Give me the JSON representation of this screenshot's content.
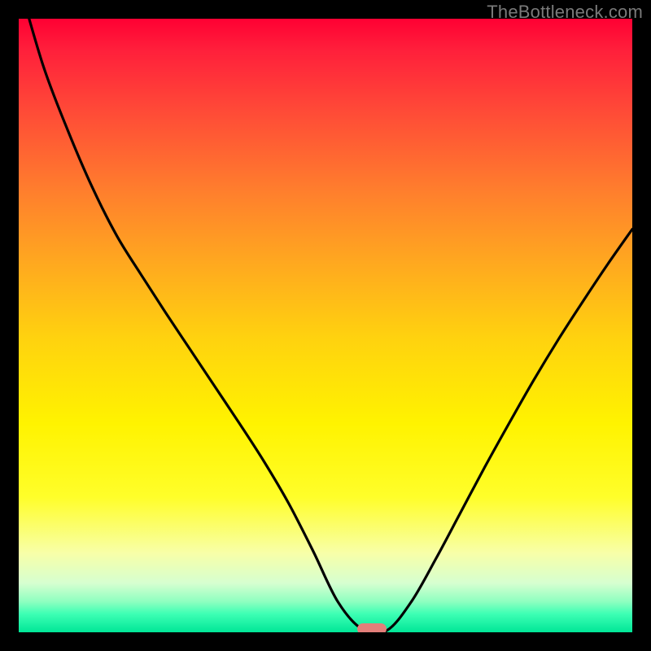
{
  "watermark": {
    "text": "TheBottleneck.com"
  },
  "colors": {
    "page_bg": "#000000",
    "curve": "#000000",
    "marker": "#e37f7a",
    "gradient_stops": [
      "#ff0033",
      "#ff1f3b",
      "#ff4a37",
      "#ff7e2d",
      "#ffa91f",
      "#ffd20f",
      "#fff300",
      "#fffe2a",
      "#f8ffa7",
      "#d6ffd0",
      "#8effc0",
      "#3dffb4",
      "#00e697"
    ]
  },
  "chart_data": {
    "type": "line",
    "title": "",
    "xlabel": "",
    "ylabel": "",
    "xlim": [
      0,
      1
    ],
    "ylim": [
      0,
      1
    ],
    "x": [
      0.0,
      0.04,
      0.08,
      0.12,
      0.16,
      0.2,
      0.24,
      0.28,
      0.32,
      0.36,
      0.4,
      0.44,
      0.48,
      0.52,
      0.56,
      0.6,
      0.64,
      0.68,
      0.72,
      0.76,
      0.8,
      0.84,
      0.88,
      0.92,
      0.96,
      1.0
    ],
    "values": [
      1.06,
      0.923,
      0.818,
      0.725,
      0.646,
      0.582,
      0.52,
      0.46,
      0.4,
      0.34,
      0.278,
      0.21,
      0.132,
      0.05,
      0.005,
      0.003,
      0.05,
      0.12,
      0.195,
      0.27,
      0.342,
      0.412,
      0.478,
      0.54,
      0.6,
      0.657
    ],
    "optimum": {
      "x": 0.575,
      "y": 0.0
    },
    "annotations": []
  }
}
